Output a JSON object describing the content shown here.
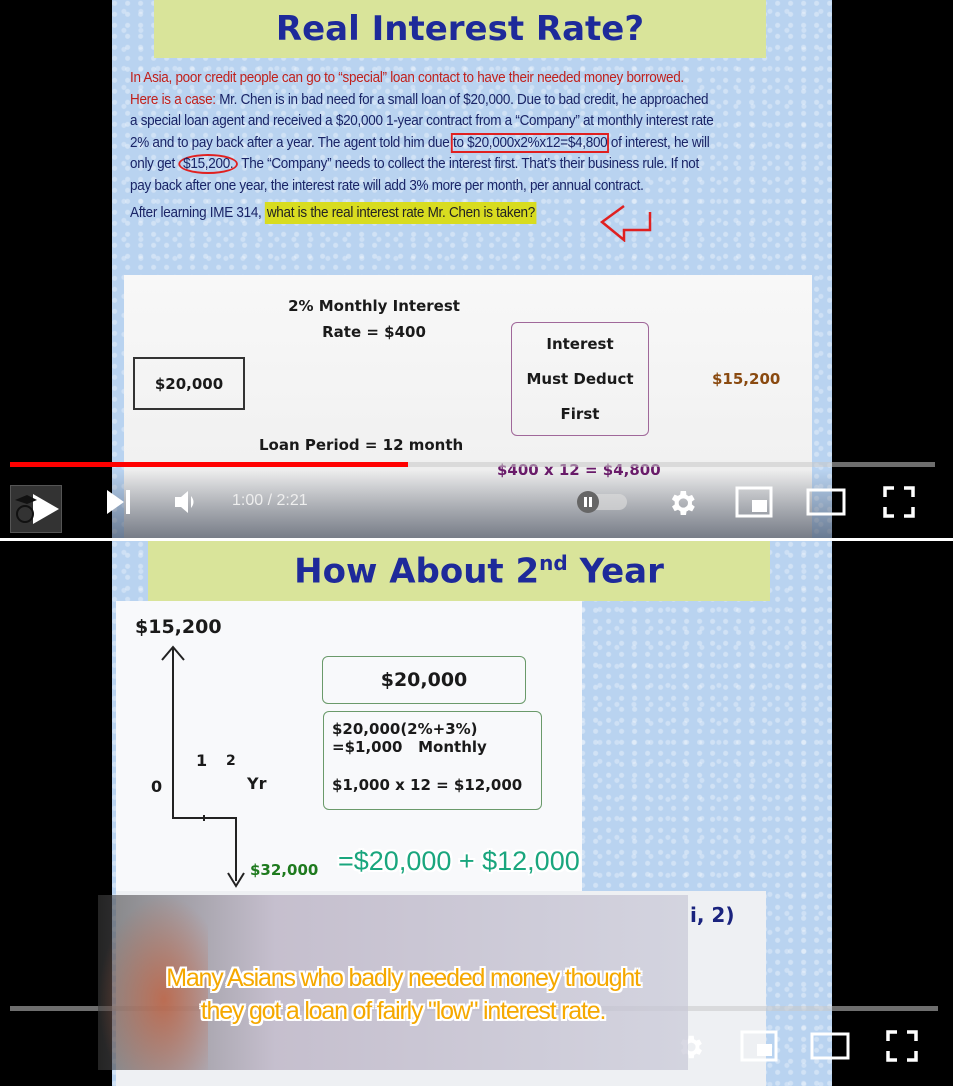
{
  "top_video": {
    "slide": {
      "title": "Real Interest Rate?",
      "intro_red": "In Asia, poor credit people can go to “special” loan contact to have their needed money borrowed.",
      "case_label": "Here is a case:",
      "case_line1": " Mr. Chen is in bad need for a small loan of $20,000.  Due to bad credit, he approached",
      "case_line2": "a special loan agent and received a $20,000 1-year contract from a “Company” at monthly interest rate",
      "case_line3a": "2% and to pay back after a year.  The agent told him due ",
      "case_line3_boxed": "to $20,000x2%x12=$4,800",
      "case_line3b": " of interest, he will",
      "case_line4a": "only get ",
      "case_line4_circled": "$15,200.",
      "case_line4b": "  The “Company” needs to collect the interest first.  That’s their business rule.  If not",
      "case_line5": "pay back after one year, the interest rate will add 3% more per month, per annual contract.",
      "question_prefix": "After learning IME 314, ",
      "question_highlight": "what is the real interest rate Mr. Chen is taken?",
      "diagram": {
        "monthly_rate_line1": "2% Monthly Interest",
        "monthly_rate_line2": "Rate = $400",
        "principal": "$20,000",
        "deduct_line1": "Interest",
        "deduct_line2": "Must Deduct",
        "deduct_line3": "First",
        "received": "$15,200",
        "loan_period": "Loan Period = 12 month",
        "total_interest": "$400 x 12 = $4,800"
      }
    },
    "controls": {
      "progress_fraction": 0.43,
      "time_display": "1:00 / 2:21",
      "autoplay": "paused"
    }
  },
  "bottom_video": {
    "slide": {
      "title_main": "How About 2",
      "title_sup": "nd",
      "title_end": " Year",
      "cashflow": {
        "top_value": "$15,200",
        "zero": "0",
        "tick1": "1",
        "tick2": "2",
        "axis_unit": "Yr",
        "bottom_value": "$32,000"
      },
      "box_principal": "$20,000",
      "box_calc_line1": "$20,000(2%+3%)",
      "box_calc_line2": "=$1,000   Monthly",
      "box_calc_line3": "$1,000 x 12 = $12,000",
      "annotation": "=$20,000 + $12,000",
      "partial_formula": "i, 2)"
    },
    "caption_line1": "Many Asians who badly needed money thought",
    "caption_line2": "they got a loan of fairly \"low\" interest rate."
  }
}
